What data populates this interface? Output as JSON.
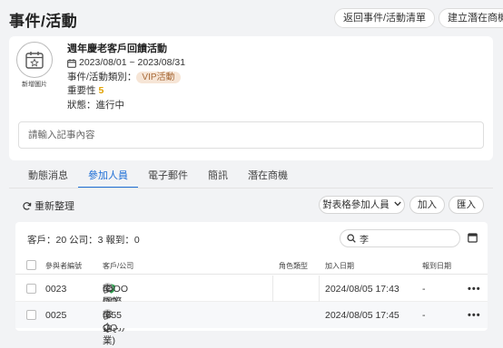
{
  "header": {
    "title": "事件/活動",
    "back_button": "返回事件/活動清單",
    "create_button": "建立潛在商機"
  },
  "event": {
    "image_caption": "新增圖片",
    "name": "週年慶老客戶回饋活動",
    "date_range": "2023/08/01 ~ 2023/08/31",
    "category_label": "事件/活動類別：",
    "category_value": "VIP活動",
    "importance_label": "重要性",
    "importance_value": "5",
    "status": "狀態：進行中",
    "note_placeholder": "請輸入記事內容"
  },
  "tabs": [
    "動態消息",
    "參加人員",
    "電子郵件",
    "簡訊",
    "潛在商機"
  ],
  "active_tab": 1,
  "toolbar": {
    "refresh": "重新整理",
    "match_button": "對表格參加人員",
    "add_button": "加入",
    "import_button": "匯入"
  },
  "table": {
    "summary": "客戶：20 公司：3 報到：0",
    "search_value": "李",
    "columns": [
      "參與者編號",
      "客戶/公司",
      "角色類型",
      "加入日期",
      "報到日期"
    ],
    "rows": [
      {
        "id": "0023",
        "name": "李OO",
        "company": "(OOO國際旅遊公司)",
        "role": "",
        "join_date": "2024/08/05 17:43",
        "checkin": "-",
        "more": "•••"
      },
      {
        "id": "0025",
        "name": "李QQ",
        "company": "(655企業)",
        "role": "",
        "join_date": "2024/08/05 17:45",
        "checkin": "-",
        "more": "•••"
      }
    ]
  },
  "colors": {
    "accent": "#1f6fd6",
    "vip_bg": "#f6e5d6",
    "vip_text": "#a86b3a",
    "importance": "#e0a000",
    "shield": "#2e9e4f"
  }
}
